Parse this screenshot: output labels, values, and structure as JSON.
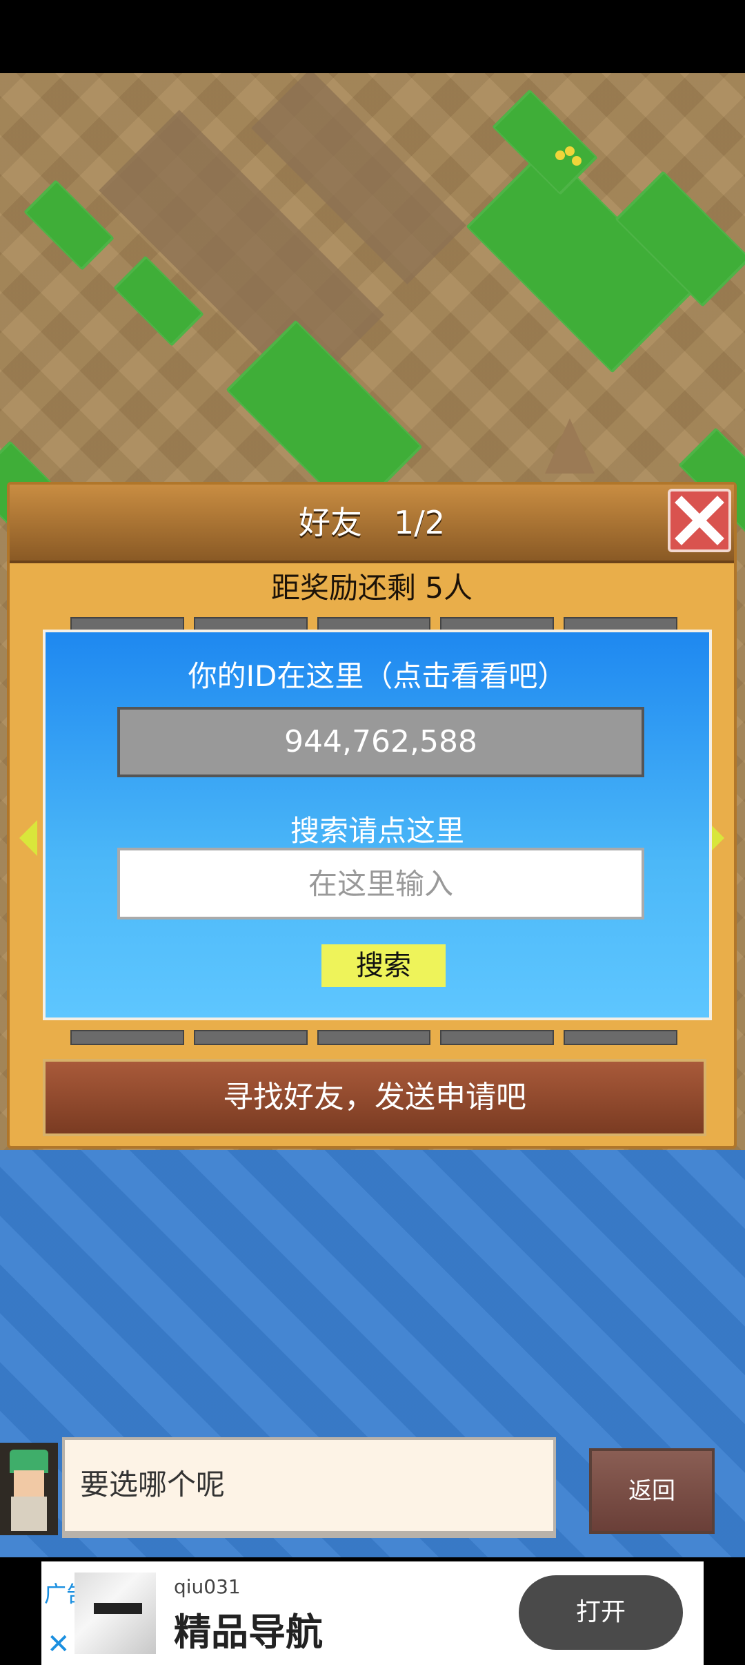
{
  "dialog": {
    "title": "好友　1/2",
    "reward_text": "距奖励还剩 5人",
    "id_label": "你的ID在这里（点击看看吧）",
    "id_value": "944,762,588",
    "search_label": "搜索请点这里",
    "search_placeholder": "在这里输入",
    "search_button": "搜索",
    "find_friend_button": "寻找好友，发送申请吧"
  },
  "chat": {
    "message": "要选哪个呢",
    "back_button": "返回"
  },
  "ad": {
    "tag": "广告",
    "account": "qiu031",
    "title": "精品导航",
    "open_button": "打开"
  },
  "colors": {
    "dialog_bg": "#e9ae4a",
    "panel_blue": "#1e88f0",
    "search_button_bg": "#eef35a",
    "close_button": "#d9534f",
    "find_button": "#7a3b22"
  },
  "icons": [
    "close-icon",
    "arrow-left-icon",
    "arrow-right-icon",
    "ad-close-icon"
  ]
}
